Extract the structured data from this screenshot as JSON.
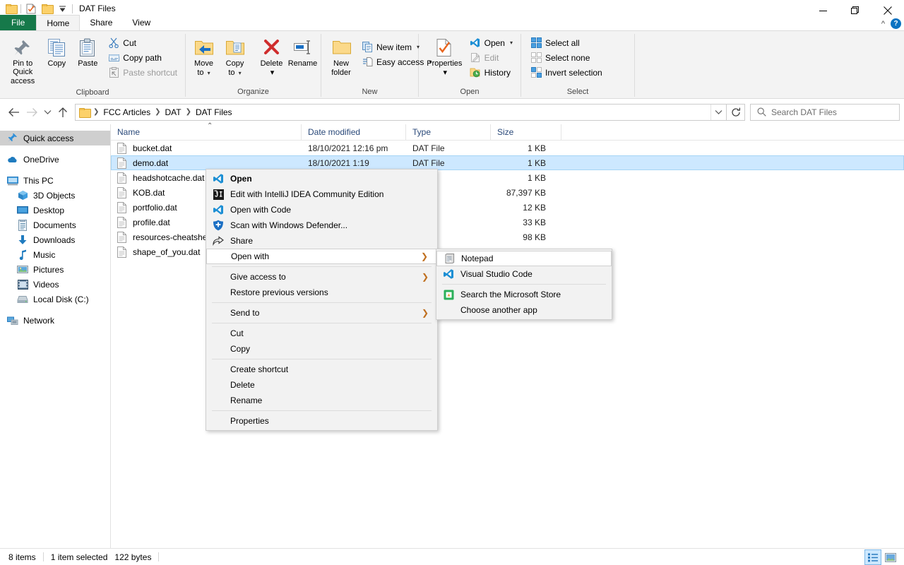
{
  "window": {
    "title": "DAT Files",
    "quick_access_icons": [
      "folder-icon",
      "properties-icon",
      "new-folder-icon",
      "customize-dropdown-icon"
    ],
    "controls": {
      "minimize": "minimize-icon",
      "maximize": "restore-icon",
      "close": "close-icon"
    }
  },
  "tabs": [
    {
      "label": "File",
      "id": "file"
    },
    {
      "label": "Home",
      "id": "home"
    },
    {
      "label": "Share",
      "id": "share"
    },
    {
      "label": "View",
      "id": "view"
    }
  ],
  "ribbon": {
    "collapse_label": "^",
    "help_label": "?",
    "groups": [
      {
        "label": "Clipboard",
        "big": [
          {
            "label": "Pin to Quick\naccess",
            "line1": "Pin to Quick",
            "line2": "access",
            "icon": "pin-icon"
          },
          {
            "label": "Copy",
            "icon": "copy-icon"
          },
          {
            "label": "Paste",
            "icon": "paste-icon"
          }
        ],
        "small": [
          {
            "label": "Cut",
            "icon": "scissors-icon",
            "disabled": false
          },
          {
            "label": "Copy path",
            "icon": "copy-path-icon",
            "disabled": false
          },
          {
            "label": "Paste shortcut",
            "icon": "paste-shortcut-icon",
            "disabled": true
          }
        ]
      },
      {
        "label": "Organize",
        "big": [
          {
            "line1": "Move",
            "line2": "to",
            "icon": "move-to-icon",
            "caret": true
          },
          {
            "line1": "Copy",
            "line2": "to",
            "icon": "copy-to-icon",
            "caret": true
          },
          {
            "line1": "Delete",
            "line2": "",
            "icon": "delete-icon",
            "caret": true
          },
          {
            "line1": "Rename",
            "line2": "",
            "icon": "rename-icon",
            "caret": false
          }
        ],
        "small": []
      },
      {
        "label": "New",
        "big": [
          {
            "line1": "New",
            "line2": "folder",
            "icon": "new-folder-icon"
          }
        ],
        "small": [
          {
            "label": "New item",
            "icon": "new-item-icon",
            "caret": true
          },
          {
            "label": "Easy access",
            "icon": "easy-access-icon",
            "caret": true,
            "disabled": false
          }
        ]
      },
      {
        "label": "Open",
        "big": [
          {
            "line1": "Properties",
            "line2": "",
            "icon": "properties-icon",
            "caret": true
          }
        ],
        "small": [
          {
            "label": "Open",
            "icon": "vscode-icon",
            "caret": true
          },
          {
            "label": "Edit",
            "icon": "edit-icon",
            "disabled": true
          },
          {
            "label": "History",
            "icon": "history-icon"
          }
        ]
      },
      {
        "label": "Select",
        "big": [],
        "small": [
          {
            "label": "Select all",
            "icon": "select-all-icon"
          },
          {
            "label": "Select none",
            "icon": "select-none-icon"
          },
          {
            "label": "Invert selection",
            "icon": "invert-selection-icon"
          }
        ]
      }
    ]
  },
  "nav": {
    "back_icon": "arrow-left-icon",
    "forward_icon": "arrow-right-icon",
    "recent_icon": "chevron-down-icon",
    "up_icon": "arrow-up-icon",
    "breadcrumbs": [
      "FCC Articles",
      "DAT",
      "DAT Files"
    ],
    "dropdown_icon": "chevron-down-icon",
    "refresh_icon": "refresh-icon",
    "search": {
      "placeholder": "Search DAT Files",
      "value": "",
      "icon": "search-icon"
    }
  },
  "sidebar": {
    "items": [
      {
        "label": "Quick access",
        "icon": "pin-star-icon",
        "level": 0,
        "selected": true
      },
      {
        "label": "OneDrive",
        "icon": "cloud-icon",
        "level": 0,
        "selected": false
      },
      {
        "label": "This PC",
        "icon": "monitor-icon",
        "level": 0,
        "selected": false
      },
      {
        "label": "3D Objects",
        "icon": "cube-icon",
        "level": 1,
        "selected": false
      },
      {
        "label": "Desktop",
        "icon": "desktop-icon",
        "level": 1,
        "selected": false
      },
      {
        "label": "Documents",
        "icon": "documents-icon",
        "level": 1,
        "selected": false
      },
      {
        "label": "Downloads",
        "icon": "download-icon",
        "level": 1,
        "selected": false
      },
      {
        "label": "Music",
        "icon": "music-note-icon",
        "level": 1,
        "selected": false
      },
      {
        "label": "Pictures",
        "icon": "picture-icon",
        "level": 1,
        "selected": false
      },
      {
        "label": "Videos",
        "icon": "video-icon",
        "level": 1,
        "selected": false
      },
      {
        "label": "Local Disk (C:)",
        "icon": "hard-drive-icon",
        "level": 1,
        "selected": false
      },
      {
        "label": "Network",
        "icon": "network-icon",
        "level": 0,
        "selected": false
      }
    ]
  },
  "filelist": {
    "columns": [
      {
        "label": "Name",
        "key": "name"
      },
      {
        "label": "Date modified",
        "key": "date"
      },
      {
        "label": "Type",
        "key": "type"
      },
      {
        "label": "Size",
        "key": "size"
      }
    ],
    "sort_indicator": "ascending",
    "rows": [
      {
        "name": "bucket.dat",
        "date": "18/10/2021 12:16 pm",
        "type": "DAT File",
        "size": "1 KB",
        "selected": false
      },
      {
        "name": "demo.dat",
        "date": "18/10/2021 1:19",
        "type": "DAT File",
        "size": "1 KB",
        "selected": true
      },
      {
        "name": "headshotcache.dat",
        "date": "",
        "type": "",
        "size": "1 KB",
        "selected": false
      },
      {
        "name": "KOB.dat",
        "date": "",
        "type": "",
        "size": "87,397 KB",
        "selected": false
      },
      {
        "name": "portfolio.dat",
        "date": "",
        "type": "",
        "size": "12 KB",
        "selected": false
      },
      {
        "name": "profile.dat",
        "date": "",
        "type": "",
        "size": "33 KB",
        "selected": false
      },
      {
        "name": "resources-cheatsheet.dat",
        "date": "",
        "type": "",
        "size": "98 KB",
        "selected": false
      },
      {
        "name": "shape_of_you.dat",
        "date": "",
        "type": "",
        "size": "",
        "selected": false
      }
    ]
  },
  "context_menu": {
    "items": [
      {
        "label": "Open",
        "icon": "vscode-icon",
        "bold": true,
        "submenu": false,
        "highlighted": false
      },
      {
        "label": "Edit with IntelliJ IDEA Community Edition",
        "icon": "intellij-icon",
        "bold": false,
        "submenu": false,
        "highlighted": false
      },
      {
        "label": "Open with Code",
        "icon": "vscode-icon",
        "bold": false,
        "submenu": false,
        "highlighted": false
      },
      {
        "label": "Scan with Windows Defender...",
        "icon": "shield-icon",
        "bold": false,
        "submenu": false,
        "highlighted": false
      },
      {
        "label": "Share",
        "icon": "share-icon",
        "bold": false,
        "submenu": false,
        "highlighted": false
      },
      {
        "label": "Open with",
        "icon": "",
        "bold": false,
        "submenu": true,
        "highlighted": true
      },
      {
        "separator": true
      },
      {
        "label": "Give access to",
        "icon": "",
        "bold": false,
        "submenu": true,
        "highlighted": false
      },
      {
        "label": "Restore previous versions",
        "icon": "",
        "bold": false,
        "submenu": false,
        "highlighted": false
      },
      {
        "separator": true
      },
      {
        "label": "Send to",
        "icon": "",
        "bold": false,
        "submenu": true,
        "highlighted": false
      },
      {
        "separator": true
      },
      {
        "label": "Cut",
        "icon": "",
        "bold": false,
        "submenu": false,
        "highlighted": false
      },
      {
        "label": "Copy",
        "icon": "",
        "bold": false,
        "submenu": false,
        "highlighted": false
      },
      {
        "separator": true
      },
      {
        "label": "Create shortcut",
        "icon": "",
        "bold": false,
        "submenu": false,
        "highlighted": false
      },
      {
        "label": "Delete",
        "icon": "",
        "bold": false,
        "submenu": false,
        "highlighted": false
      },
      {
        "label": "Rename",
        "icon": "",
        "bold": false,
        "submenu": false,
        "highlighted": false
      },
      {
        "separator": true
      },
      {
        "label": "Properties",
        "icon": "",
        "bold": false,
        "submenu": false,
        "highlighted": false
      }
    ]
  },
  "open_with_submenu": {
    "items": [
      {
        "label": "Notepad",
        "icon": "notepad-icon",
        "highlighted": true
      },
      {
        "label": "Visual Studio Code",
        "icon": "vscode-icon",
        "highlighted": false
      },
      {
        "separator": true
      },
      {
        "label": "Search the Microsoft Store",
        "icon": "store-icon",
        "highlighted": false
      },
      {
        "label": "Choose another app",
        "icon": "",
        "highlighted": false
      }
    ]
  },
  "statusbar": {
    "item_count": "8 items",
    "selection": "1 item selected",
    "selection_size": "122 bytes",
    "views": [
      {
        "name": "details-view",
        "active": true
      },
      {
        "name": "large-icons-view",
        "active": false
      }
    ]
  },
  "colors": {
    "accent": "#0a73c2",
    "file_tab_green": "#16794a",
    "selection_blue": "#cde8ff",
    "header_text": "#2b4a7a"
  }
}
